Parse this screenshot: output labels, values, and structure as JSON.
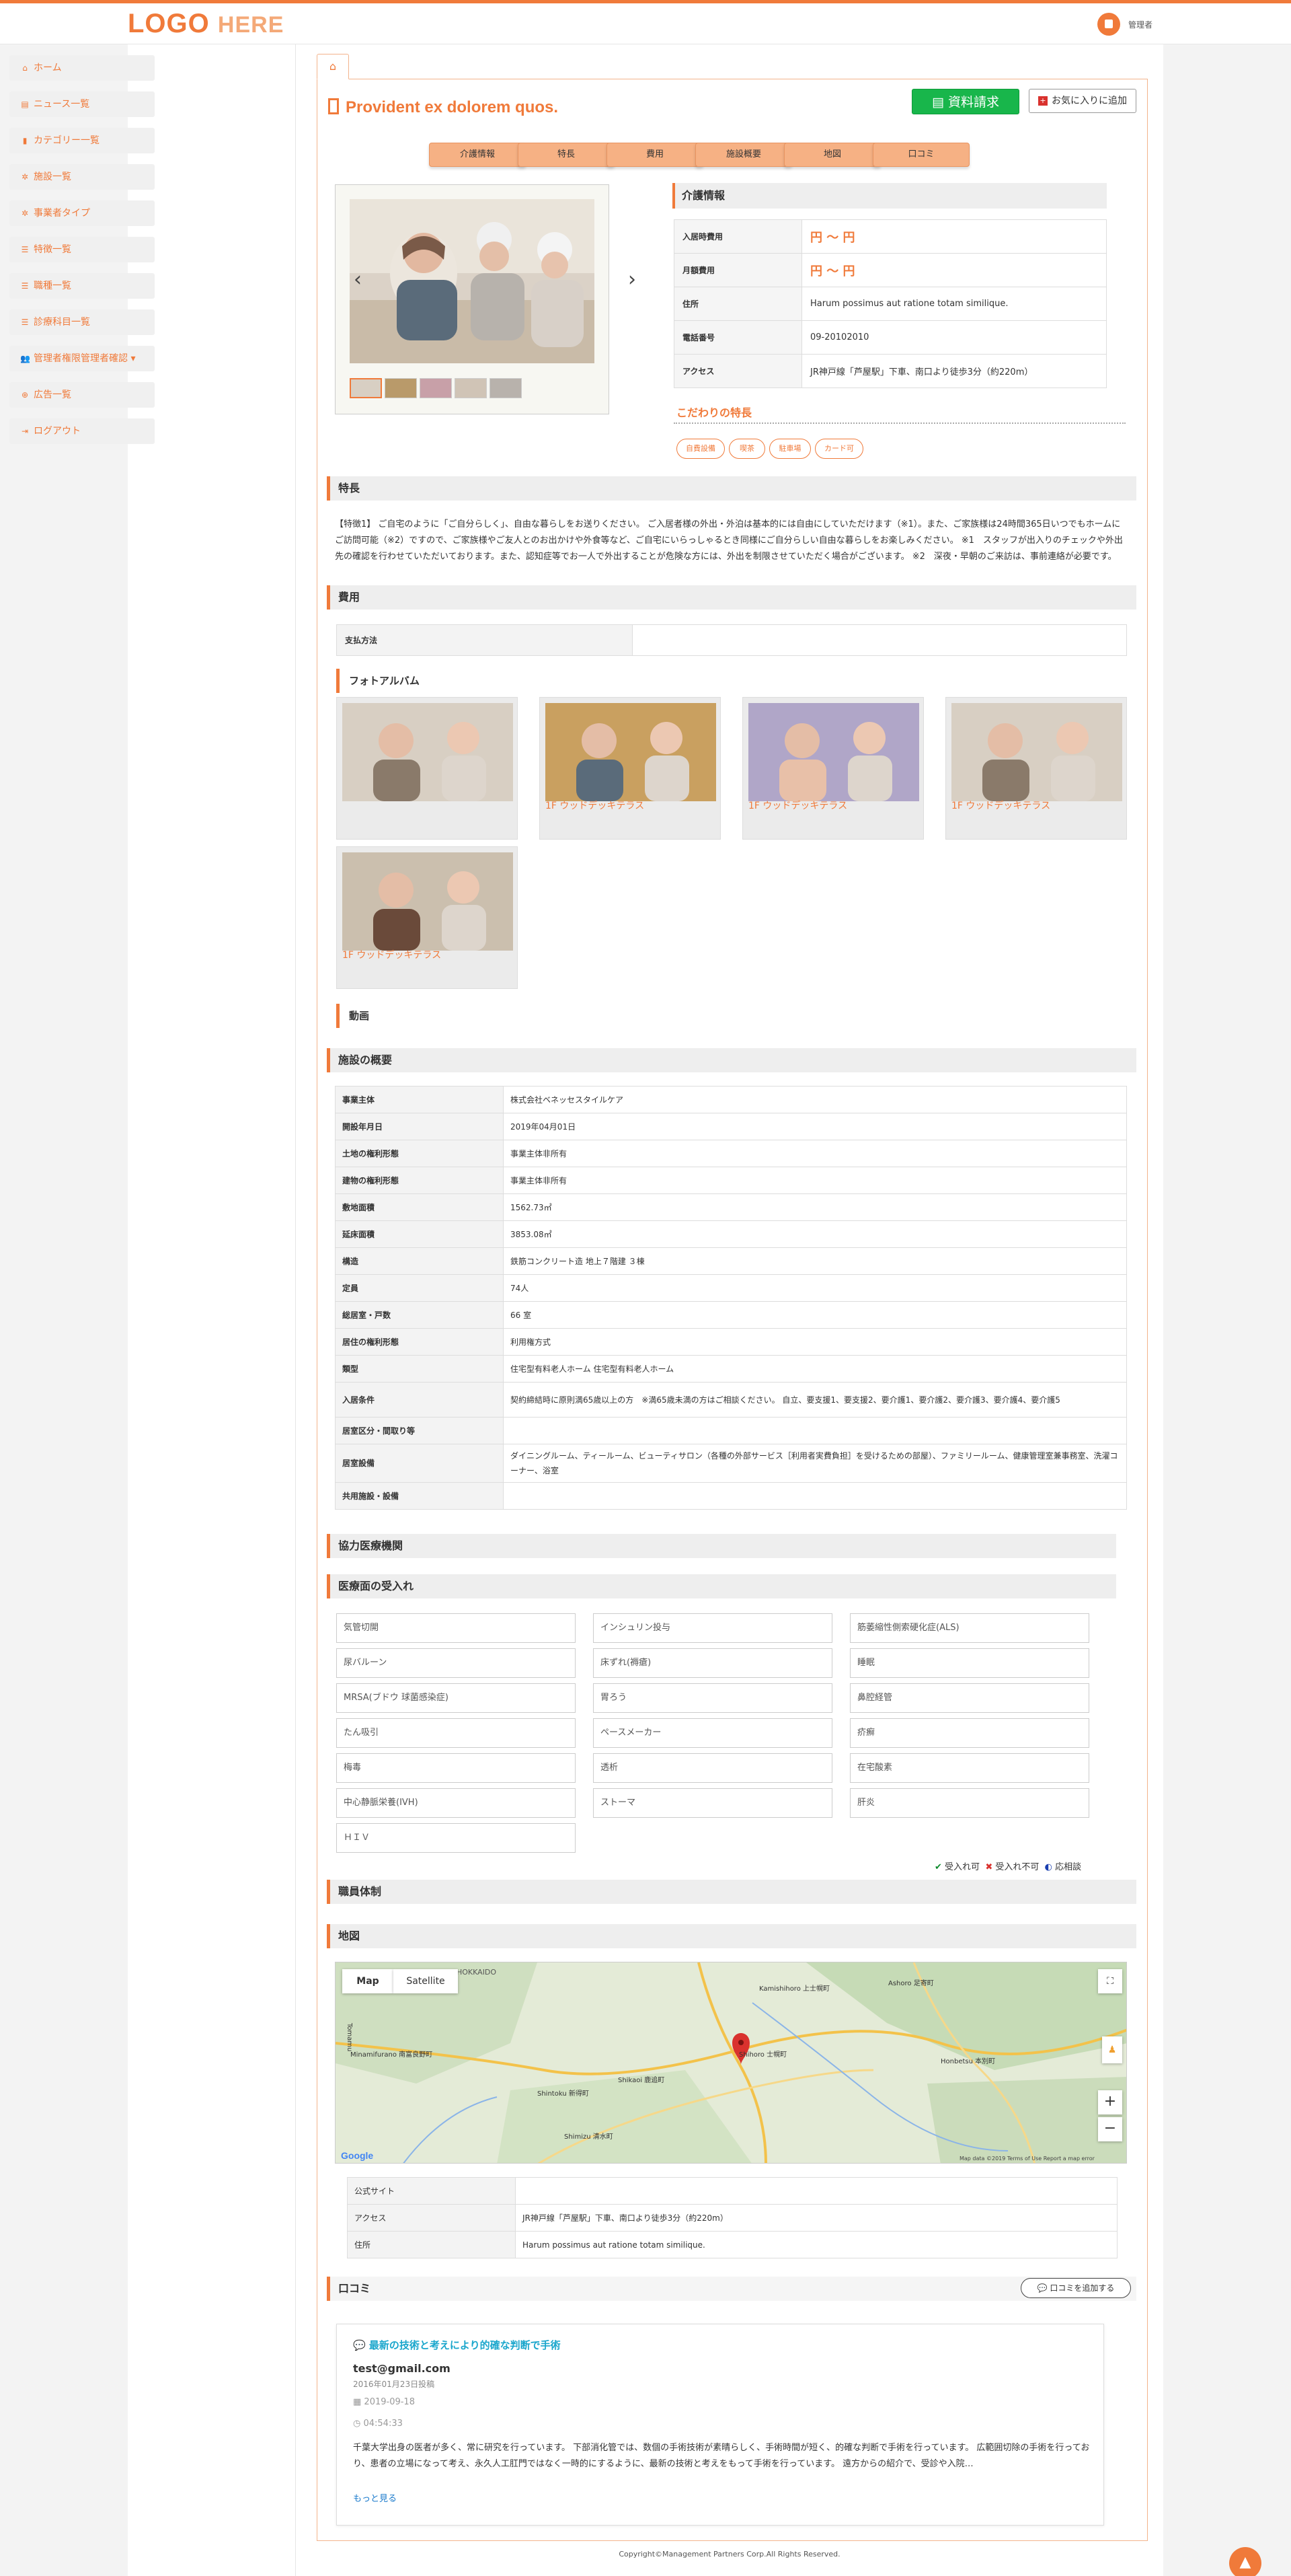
{
  "header": {
    "logo_main": "LOGO",
    "logo_sub": "HERE",
    "admin_name": "管理者"
  },
  "sidebar": {
    "items": [
      {
        "icon": "home-icon",
        "glyph": "⌂",
        "label": "ホーム"
      },
      {
        "icon": "newspaper-icon",
        "glyph": "▤",
        "label": "ニュース一覧"
      },
      {
        "icon": "file-icon",
        "glyph": "▮",
        "label": "カテゴリー一覧"
      },
      {
        "icon": "asterisk-icon",
        "glyph": "✲",
        "label": "施設一覧"
      },
      {
        "icon": "asterisk-icon",
        "glyph": "✲",
        "label": "事業者タイプ"
      },
      {
        "icon": "list-icon",
        "glyph": "☰",
        "label": "特徴一覧"
      },
      {
        "icon": "list-icon",
        "glyph": "☰",
        "label": "職種一覧"
      },
      {
        "icon": "list-icon",
        "glyph": "☰",
        "label": "診療科目一覧"
      },
      {
        "icon": "users-icon",
        "glyph": "👥",
        "label": "管理者権限管理者確認 ▾"
      },
      {
        "icon": "globe-icon",
        "glyph": "⊕",
        "label": "広告一覧"
      },
      {
        "icon": "logout-icon",
        "glyph": "⇥",
        "label": "ログアウト"
      }
    ]
  },
  "facility": {
    "title": "Provident ex dolorem quos.",
    "doc_button": "資料請求",
    "fav_button": "お気に入りに追加",
    "tabs": [
      "介護情報",
      "特長",
      "費用",
      "施設概要",
      "地図",
      "口コミ"
    ],
    "care_header": "介護情報",
    "care": [
      {
        "k": "入居時費用",
        "v": "円 ～ 円",
        "price": true
      },
      {
        "k": "月額費用",
        "v": "円 ～ 円",
        "price": true
      },
      {
        "k": "住所",
        "v": "Harum possimus aut ratione totam similique.",
        "price": false
      },
      {
        "k": "電話番号",
        "v": "09-20102010",
        "price": false
      },
      {
        "k": "アクセス",
        "v": "JR神戸線「芦屋駅」下車、南口より徒歩3分（約220m）",
        "price": false
      }
    ],
    "kodawari_title": "こだわりの特長",
    "tags": [
      "自費設備",
      "喫茶",
      "駐車場",
      "カード可"
    ]
  },
  "features": {
    "header": "特長",
    "text": "【特徴1】 ご自宅のように「ご自分らしく」、自由な暮らしをお送りください。 ご入居者様の外出・外泊は基本的には自由にしていただけます（※1）。また、ご家族様は24時間365日いつでもホームにご訪問可能（※2）ですので、ご家族様やご友人とのお出かけや外食等など、ご自宅にいらっしゃるとき同様にご自分らしい自由な暮らしをお楽しみください。 ※1　スタッフが出入りのチェックや外出先の確認を行わせていただいております。また、認知症等でお一人で外出することが危険な方には、外出を制限させていただく場合がございます。 ※2　深夜・早朝のご来訪は、事前連絡が必要です。"
  },
  "cost": {
    "header": "費用",
    "payment_label": "支払方法",
    "payment_value": ""
  },
  "album": {
    "header": "フォトアルバム",
    "photos": [
      {
        "caption": ""
      },
      {
        "caption": "1F ウッドデッキテラス"
      },
      {
        "caption": "1F ウッドデッキテラス"
      },
      {
        "caption": "1F ウッドデッキテラス"
      },
      {
        "caption": "1F ウッドデッキテラス"
      }
    ]
  },
  "video": {
    "header": "動画"
  },
  "overview": {
    "header": "施設の概要",
    "rows": [
      {
        "k": "事業主体",
        "v": "株式会社ベネッセスタイルケア"
      },
      {
        "k": "開設年月日",
        "v": "2019年04月01日"
      },
      {
        "k": "土地の権利形態",
        "v": "事業主体非所有"
      },
      {
        "k": "建物の権利形態",
        "v": "事業主体非所有"
      },
      {
        "k": "敷地面積",
        "v": "1562.73㎡"
      },
      {
        "k": "延床面積",
        "v": "3853.08㎡"
      },
      {
        "k": "構造",
        "v": "鉄筋コンクリート造 地上７階建 ３棟"
      },
      {
        "k": "定員",
        "v": "74人"
      },
      {
        "k": "総居室・戸数",
        "v": "66 室"
      },
      {
        "k": "居住の権利形態",
        "v": "利用権方式"
      },
      {
        "k": "類型",
        "v": "住宅型有料老人ホーム 住宅型有料老人ホーム"
      },
      {
        "k": "入居条件",
        "v": "契約締結時に原則満65歳以上の方　※満65歳未満の方はご相談ください。 自立、要支援1、要支援2、要介護1、要介護2、要介護3、要介護4、要介護5"
      },
      {
        "k": "居室区分・間取り等",
        "v": ""
      },
      {
        "k": "居室設備",
        "v": "ダイニングルーム、ティールーム、ビューティサロン（各種の外部サービス［利用者実費負担］を受けるための部屋）、ファミリールーム、健康管理室兼事務室、洗濯コーナー、浴室"
      },
      {
        "k": "共用施設・設備",
        "v": ""
      }
    ]
  },
  "cooperation": {
    "header": "協力医療機関"
  },
  "medical": {
    "header": "医療面の受入れ",
    "items": [
      "気管切開",
      "インシュリン投与",
      "筋萎縮性側索硬化症(ALS)",
      "尿バルーン",
      "床ずれ(褥瘡)",
      "睡眠",
      "MRSA(ブドウ 球菌感染症)",
      "胃ろう",
      "鼻腔経管",
      "たん吸引",
      "ペースメーカー",
      "疥癬",
      "梅毒",
      "透析",
      "在宅酸素",
      "中心静脈栄養(IVH)",
      "ストーマ",
      "肝炎",
      "ＨＩＶ"
    ],
    "legend": {
      "ok": "受入れ可",
      "ng": "受入れ不可",
      "consult": "応相談"
    }
  },
  "staff": {
    "header": "職員体制"
  },
  "map": {
    "header": "地図",
    "type_map": "Map",
    "type_sat": "Satellite",
    "labels": [
      "HOKKAIDO",
      "Kamishihoro 上士幌町",
      "Ashoro 足寄町",
      "Shihoro 士幌町",
      "Honbetsu 本別町",
      "Minamifurano 南富良野町",
      "Shikaoi 鹿追町",
      "Shintoku 新得町",
      "Shimizu 清水町",
      "Tomamu"
    ],
    "footer": "Map data ©2019   Terms of Use   Report a map error",
    "access_rows": [
      {
        "k": "公式サイト",
        "v": ""
      },
      {
        "k": "アクセス",
        "v": "JR神戸線「芦屋駅」下車、南口より徒歩3分（約220m）"
      },
      {
        "k": "住所",
        "v": "Harum possimus aut ratione totam similique."
      }
    ]
  },
  "reviews": {
    "header": "口コミ",
    "add_button": "口コミを追加する",
    "item": {
      "title": "最新の技術と考えにより的確な判断で手術",
      "email": "test@gmail.com",
      "posted": "2016年01月23日投稿",
      "date": "2019-09-18",
      "time": "04:54:33",
      "body": "千葉大学出身の医者が多く、常に研究を行っています。 下部消化管では、数個の手術技術が素晴らしく、手術時間が短く、的確な判断で手術を行っています。 広範囲切除の手術を行っており、患者の立場になって考え、永久人工肛門ではなく一時的にするように、最新の技術と考えをもって手術を行っています。 遠方からの紹介で、受診や入院…",
      "more": "もっと見る"
    }
  },
  "footer": {
    "copyright": "Copyright©Management Partners Corp.All Rights Reserved."
  },
  "colors": {
    "accent": "#f07a3a",
    "green": "#18b64b"
  }
}
